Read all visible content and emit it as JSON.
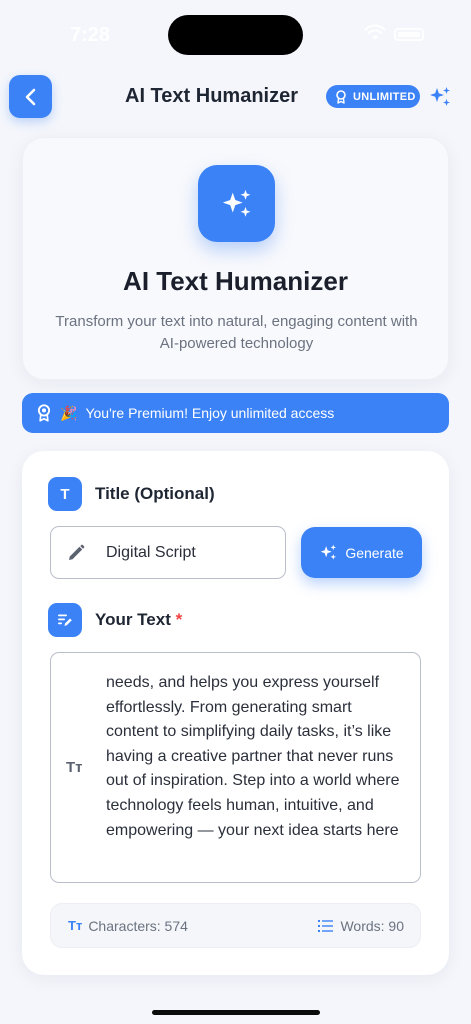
{
  "status_bar": {
    "time": "7:28"
  },
  "header": {
    "back_icon": "chevron-left-icon",
    "title": "AI Text Humanizer",
    "badge_label": "UNLIMITED",
    "badge_icon": "award-icon",
    "sparkle_icon": "sparkles-icon"
  },
  "hero": {
    "icon": "sparkles-icon",
    "title": "AI Text Humanizer",
    "subtitle": "Transform your text into natural, engaging content with AI-powered technology"
  },
  "premium_banner": {
    "icon": "award-icon",
    "emoji": "🎉",
    "text": "You're Premium! Enjoy unlimited access"
  },
  "title_section": {
    "icon_glyph": "T",
    "label": "Title (Optional)",
    "input_value": "Digital Script",
    "input_icon": "pencil-icon",
    "generate_label": "Generate"
  },
  "text_section": {
    "label": "Your Text",
    "required_mark": "*",
    "icon_glyph": "Tт",
    "content": "needs, and helps you express yourself effortlessly. From generating smart content to simplifying daily tasks, it’s like having a creative partner that never runs out of inspiration. Step into a world where technology feels human, intuitive, and empowering — your next idea starts here"
  },
  "stats": {
    "characters_icon": "Tт",
    "characters_label": "Characters: 574",
    "words_label": "Words: 90"
  },
  "colors": {
    "accent": "#3b82f6",
    "required": "#ef4444",
    "background": "#f4f6fb"
  }
}
